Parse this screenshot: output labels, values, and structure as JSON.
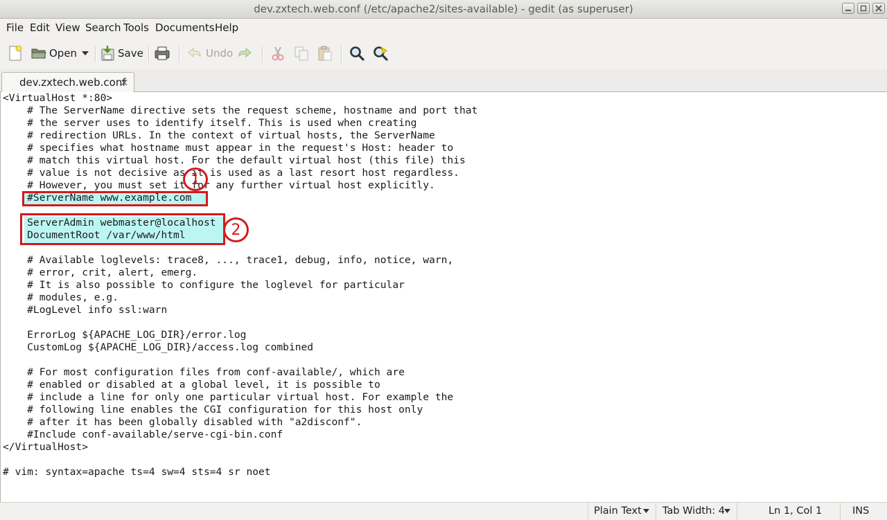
{
  "window": {
    "title": "dev.zxtech.web.conf (/etc/apache2/sites-available) - gedit (as superuser)"
  },
  "menubar": [
    "File",
    "Edit",
    "View",
    "Search",
    "Tools",
    "Documents",
    "Help"
  ],
  "toolbar": {
    "open_label": "Open",
    "save_label": "Save",
    "undo_label": "Undo"
  },
  "tab": {
    "label": "dev.zxtech.web.conf",
    "close": "×"
  },
  "editor": {
    "lines": [
      "<VirtualHost *:80>",
      "    # The ServerName directive sets the request scheme, hostname and port that",
      "    # the server uses to identify itself. This is used when creating",
      "    # redirection URLs. In the context of virtual hosts, the ServerName",
      "    # specifies what hostname must appear in the request's Host: header to",
      "    # match this virtual host. For the default virtual host (this file) this",
      "    # value is not decisive as it is used as a last resort host regardless.",
      "    # However, you must set it for any further virtual host explicitly.",
      "    #ServerName www.example.com",
      "",
      "    ServerAdmin webmaster@localhost",
      "    DocumentRoot /var/www/html",
      "",
      "    # Available loglevels: trace8, ..., trace1, debug, info, notice, warn,",
      "    # error, crit, alert, emerg.",
      "    # It is also possible to configure the loglevel for particular",
      "    # modules, e.g.",
      "    #LogLevel info ssl:warn",
      "",
      "    ErrorLog ${APACHE_LOG_DIR}/error.log",
      "    CustomLog ${APACHE_LOG_DIR}/access.log combined",
      "",
      "    # For most configuration files from conf-available/, which are",
      "    # enabled or disabled at a global level, it is possible to",
      "    # include a line for only one particular virtual host. For example the",
      "    # following line enables the CGI configuration for this host only",
      "    # after it has been globally disabled with \"a2disconf\".",
      "    #Include conf-available/serve-cgi-bin.conf",
      "</VirtualHost>",
      "",
      "# vim: syntax=apache ts=4 sw=4 sts=4 sr noet"
    ]
  },
  "annotations": [
    "1",
    "2"
  ],
  "statusbar": {
    "language": "Plain Text",
    "tab_width": "Tab Width: 4",
    "position": "Ln 1, Col 1",
    "mode": "INS"
  },
  "colors": {
    "highlight": "#bbf6f4",
    "annotation_red": "#d3191d"
  }
}
